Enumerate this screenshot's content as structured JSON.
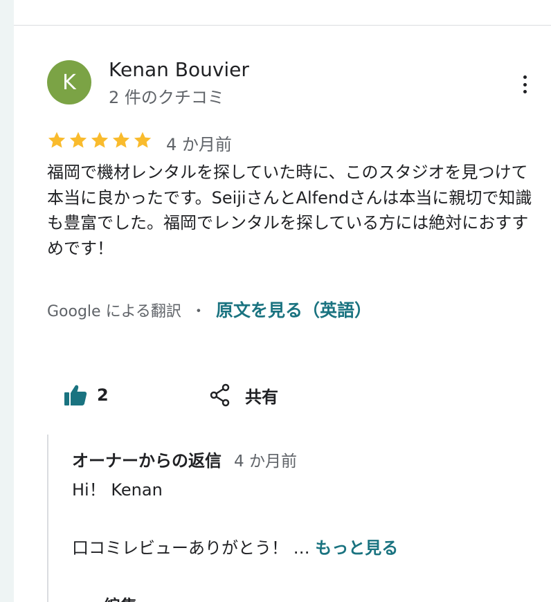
{
  "review": {
    "avatar_initial": "K",
    "avatar_color": "#7ba345",
    "reviewer_name": "Kenan Bouvier",
    "review_count": "2 件のクチコミ",
    "rating": 5,
    "max_rating": 5,
    "star_color": "#f9bb2d",
    "date": "4 か月前",
    "text": "福岡で機材レンタルを探していた時に、このスタジオを見つけて本当に良かったです。SeijiさんとAlfendさんは本当に親切で知識も豊富でした。福岡でレンタルを探している方には絶対におすすめです！",
    "translation_label": "Google による翻訳",
    "translation_separator": "・",
    "view_original_label": "原文を見る（英語）",
    "link_color": "#1a7380"
  },
  "actions": {
    "like_icon": "thumbs-up-icon",
    "like_count": "2",
    "share_icon": "share-icon",
    "share_label": "共有"
  },
  "owner_reply": {
    "title": "オーナーからの返信",
    "date": "4 か月前",
    "greeting": "Hi！ Kenan",
    "body": "口コミレビューありがとう！ … ",
    "more_label": "もっと見る",
    "cutoff_text": "編集"
  }
}
